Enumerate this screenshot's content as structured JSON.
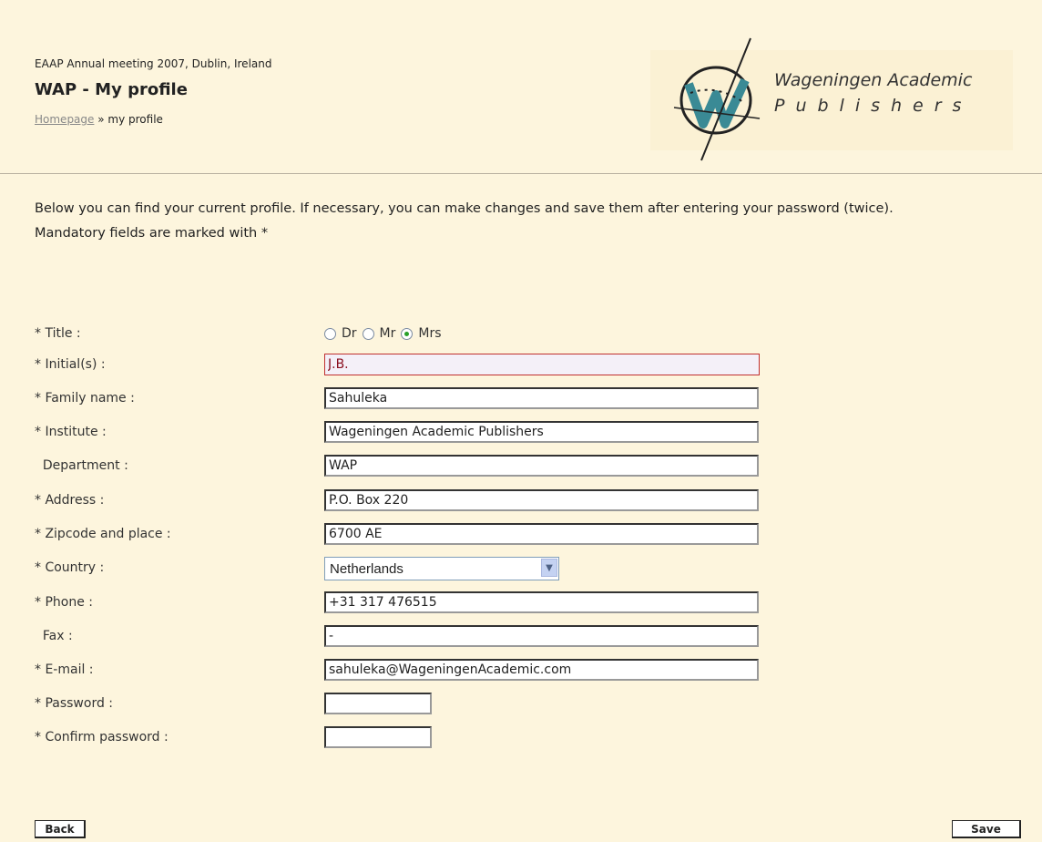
{
  "header": {
    "event": "EAAP Annual meeting 2007, Dublin, Ireland",
    "title": "WAP - My profile",
    "breadcrumb_link": "Homepage",
    "breadcrumb_sep": " » ",
    "breadcrumb_current": "my profile",
    "logo_line1": "Wageningen Academic",
    "logo_line2": "Publishers"
  },
  "intro": {
    "text": "Below you can find your current profile. If necessary, you can make changes and save them after entering your password (twice).",
    "mandatory": "Mandatory fields are marked with *"
  },
  "form": {
    "title": {
      "label": "* Title :",
      "options": [
        "Dr",
        "Mr",
        "Mrs"
      ],
      "selected": "Mrs"
    },
    "initials": {
      "label": "* Initial(s) :",
      "value": "J.B."
    },
    "family_name": {
      "label": "* Family name :",
      "value": "Sahuleka"
    },
    "institute": {
      "label": "* Institute :",
      "value": "Wageningen Academic Publishers"
    },
    "department": {
      "label": "  Department :",
      "value": "WAP"
    },
    "address": {
      "label": "* Address :",
      "value": "P.O. Box 220"
    },
    "zipcode": {
      "label": "* Zipcode and place :",
      "value": "6700 AE"
    },
    "country": {
      "label": "* Country :",
      "value": "Netherlands"
    },
    "phone": {
      "label": "* Phone :",
      "value": "+31 317 476515"
    },
    "fax": {
      "label": "  Fax :",
      "value": "-"
    },
    "email": {
      "label": "* E-mail :",
      "value": "sahuleka@WageningenAcademic.com"
    },
    "password": {
      "label": "* Password :",
      "value": ""
    },
    "confirm_password": {
      "label": "* Confirm password :",
      "value": ""
    }
  },
  "buttons": {
    "back": "Back",
    "save": "Save"
  },
  "colors": {
    "background": "#fdf5dd",
    "logo_teal": "#3a8a95",
    "error_border": "#c03030"
  }
}
